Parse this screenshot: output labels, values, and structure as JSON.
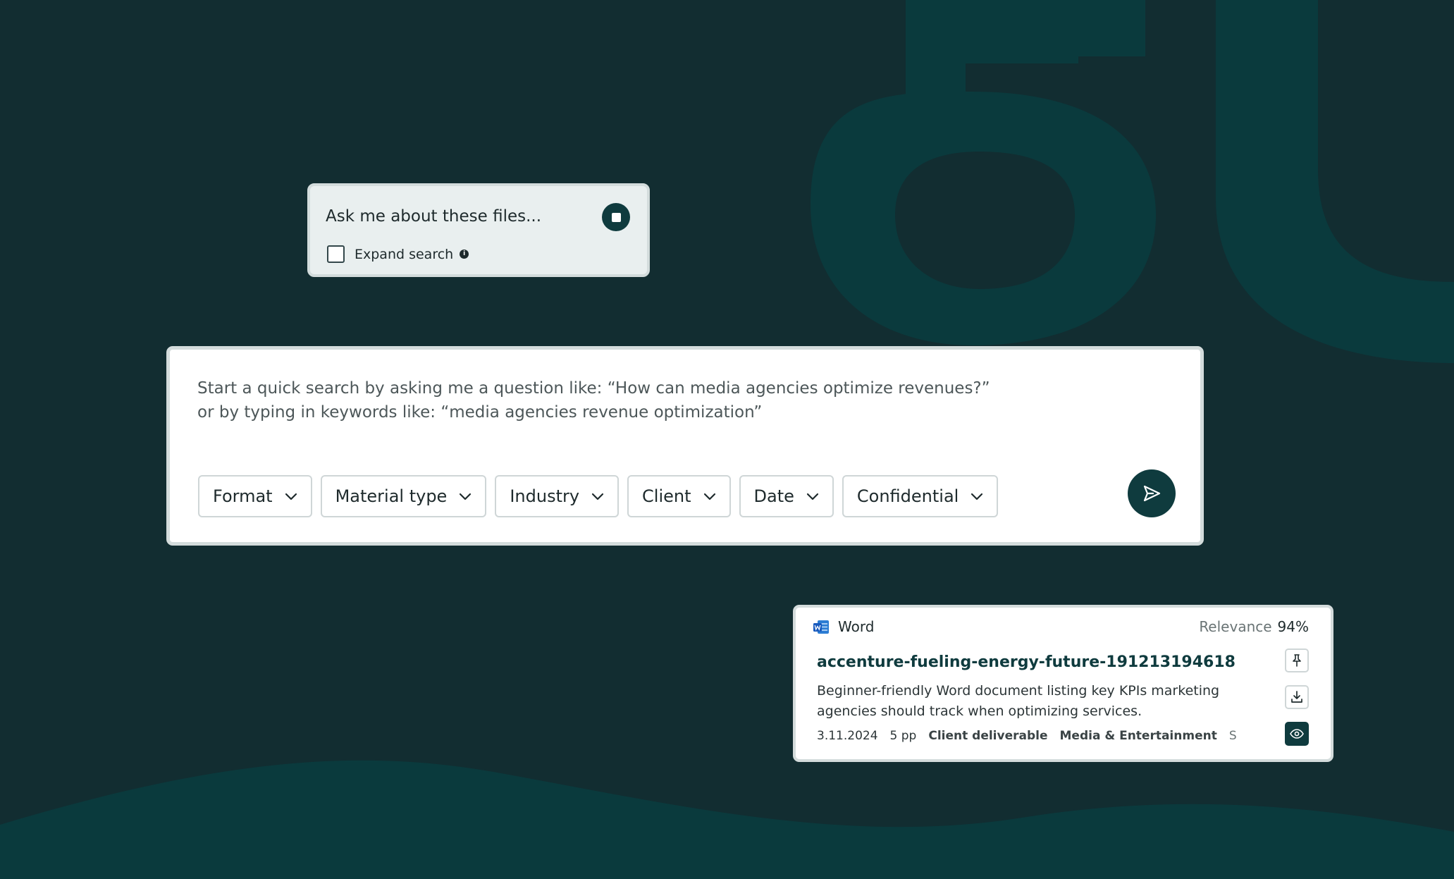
{
  "colors": {
    "background": "#122d31",
    "accent": "#0f3b3e",
    "decor": "#0a3a3d"
  },
  "ask_card": {
    "placeholder": "Ask me about these files...",
    "stop_icon": "stop-icon",
    "expand_label": "Expand search",
    "info_icon": "info-icon"
  },
  "search": {
    "prompt_line1": "Start a quick search by asking me a question like: “How can media agencies optimize revenues?”",
    "prompt_line2": "or by typing in keywords like: “media agencies revenue optimization”",
    "filters": [
      "Format",
      "Material type",
      "Industry",
      "Client",
      "Date",
      "Confidential"
    ],
    "send_icon": "send-icon"
  },
  "result": {
    "source": "Word",
    "source_icon": "word-icon",
    "relevance_label": "Relevance",
    "relevance_value": "94%",
    "title": "accenture-fueling-energy-future-191213194618",
    "description": "Beginner-friendly Word document listing key KPIs marketing agencies should track when optimizing services.",
    "date": "3.11.2024",
    "pages": "5 pp",
    "material_type": "Client deliverable",
    "industry": "Media & Entertainment",
    "extra": "S",
    "actions": [
      "pin-icon",
      "download-icon",
      "preview-icon"
    ]
  }
}
